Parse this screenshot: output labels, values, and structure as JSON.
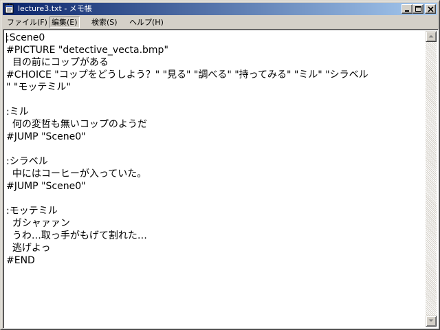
{
  "window": {
    "title": "lecture3.txt - メモ帳",
    "titlebar_color_start": "#0a246a",
    "titlebar_color_end": "#a6caf0"
  },
  "menu": {
    "items": [
      {
        "label": "ファイル(F)"
      },
      {
        "label": "編集(E)"
      },
      {
        "label": "検索(S)"
      },
      {
        "label": "ヘルプ(H)"
      }
    ]
  },
  "editor": {
    "lines": [
      ":Scene0",
      "#PICTURE \"detective_vecta.bmp\"",
      "  目の前にコップがある",
      "#CHOICE \"コップをどうしよう？\" \"見る\" \"調べる\" \"持ってみる\" \"ミル\" \"シラベル",
      "\" \"モッテミル\"",
      "",
      ":ミル",
      "  何の変哲も無いコップのようだ",
      "#JUMP \"Scene0\"",
      "",
      ":シラベル",
      "  中にはコーヒーが入っていた。",
      "#JUMP \"Scene0\"",
      "",
      ":モッテミル",
      "  ガシャァァン",
      "  うわ…取っ手がもげて割れた…",
      "  逃げよっ",
      "#END"
    ]
  },
  "icons": {
    "app": "notepad-icon",
    "minimize": "minimize-icon",
    "maximize": "maximize-icon",
    "close": "close-icon",
    "scroll_up": "arrow-up-icon",
    "scroll_down": "arrow-down-icon"
  }
}
